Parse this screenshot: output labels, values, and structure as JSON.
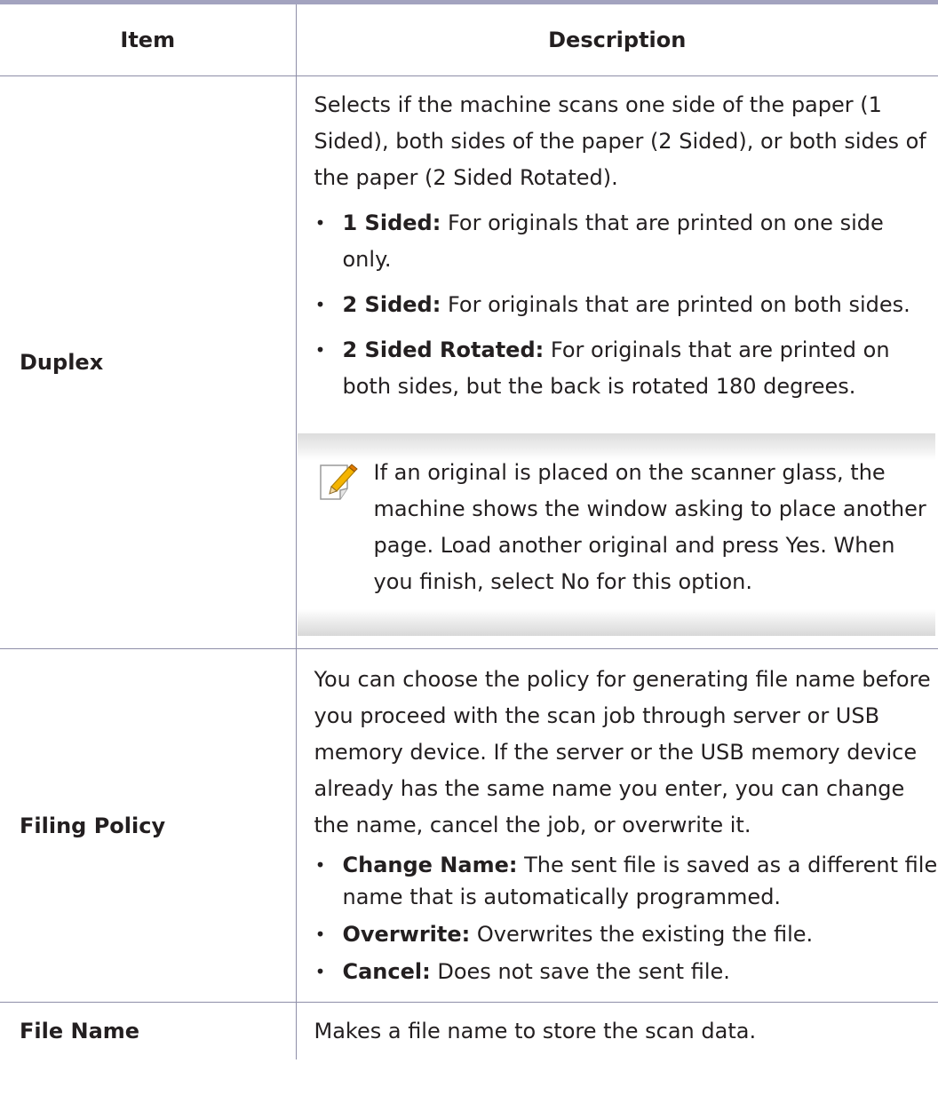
{
  "table": {
    "headers": {
      "item": "Item",
      "description": "Description"
    },
    "duplex": {
      "item": "Duplex",
      "intro": "Selects if the machine scans one side of the paper (1 Sided), both sides of the paper (2 Sided), or both sides of the paper (2 Sided Rotated).",
      "options": [
        {
          "term": "1 Sided:",
          "text": "For originals that are printed on one side only."
        },
        {
          "term": "2 Sided:",
          "text": "For originals that are printed on both sides."
        },
        {
          "term": "2 Sided Rotated:",
          "text": "For originals that are printed on both sides, but the back is rotated 180 degrees."
        }
      ],
      "note": {
        "icon": "note-pencil-icon",
        "text": "If an original is placed on the scanner glass, the machine shows the window asking to place another page. Load another original and press Yes. When you finish, select No for this option."
      }
    },
    "filing_policy": {
      "item": "Filing Policy",
      "intro": "You can choose the policy for generating file name before you proceed with the scan job through server or USB memory device. If the server or the USB memory device already has the same name you enter, you can change the name, cancel the job, or overwrite it.",
      "options": [
        {
          "term": "Change Name:",
          "text": "The sent file is saved as a different file name that is automatically programmed."
        },
        {
          "term": "Overwrite:",
          "text": "Overwrites the existing the file."
        },
        {
          "term": "Cancel:",
          "text": "Does not save the sent file."
        }
      ]
    },
    "file_name": {
      "item": "File Name",
      "description": "Makes a file name to store the scan data."
    }
  },
  "colors": {
    "rule": "#8e8ea8",
    "header_top_rule": "#a3a3bf",
    "text": "#231f20",
    "note_icon_accent": "#f5b400"
  }
}
